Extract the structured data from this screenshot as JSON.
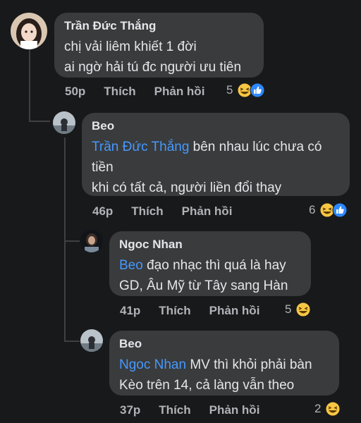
{
  "comments": [
    {
      "author": "Trần Đức Thắng",
      "mention": "",
      "line1": "chị vải liêm khiết 1 đời",
      "line2": "ai ngờ hải tú đc người ưu tiên",
      "time": "50p",
      "like": "Thích",
      "reply": "Phản hồi",
      "count": "5",
      "reactions": [
        "haha-icon",
        "like-icon"
      ]
    },
    {
      "author": "Beo",
      "mention": "Trần Đức Thắng",
      "line1_rest": " bên nhau lúc chưa có",
      "line2": "tiền",
      "line3": "khi có tất cả, người liền đổi thay",
      "time": "46p",
      "like": "Thích",
      "reply": "Phản hồi",
      "count": "6",
      "reactions": [
        "haha-icon",
        "like-icon"
      ]
    },
    {
      "author": "Ngoc Nhan",
      "mention": "Beo",
      "line1_rest": " đạo nhạc thì quá là hay",
      "line2": "GD, Âu Mỹ từ Tây sang Hàn",
      "time": "41p",
      "like": "Thích",
      "reply": "Phản hồi",
      "count": "5",
      "reactions": [
        "haha-icon"
      ]
    },
    {
      "author": "Beo",
      "mention": "Ngoc Nhan",
      "line1_rest": " MV thì khỏi phải bàn",
      "line2": "Kèo trên 14, cả làng vẫn theo",
      "time": "37p",
      "like": "Thích",
      "reply": "Phản hồi",
      "count": "2",
      "reactions": [
        "haha-icon"
      ]
    }
  ]
}
